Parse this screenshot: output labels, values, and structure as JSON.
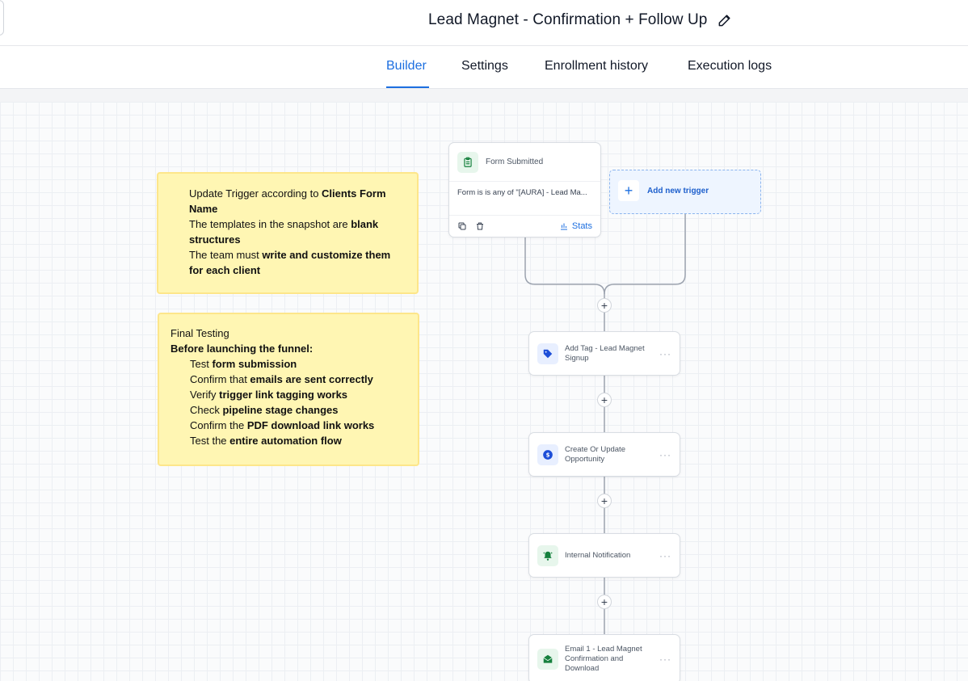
{
  "header": {
    "title": "Lead Magnet - Confirmation + Follow Up"
  },
  "tabs": [
    {
      "label": "Builder",
      "active": true
    },
    {
      "label": "Settings",
      "active": false
    },
    {
      "label": "Enrollment history",
      "active": false
    },
    {
      "label": "Execution logs",
      "active": false
    }
  ],
  "notes": {
    "note1": {
      "l1a": "Update Trigger according to ",
      "l1b": "Clients Form Name",
      "l2a": "The templates in the snapshot are ",
      "l2b": "blank structures",
      "l3a": "The team must ",
      "l3b": "write and customize them for each client"
    },
    "note2": {
      "heading": "Final Testing",
      "subheading": "Before launching the funnel:",
      "items": [
        {
          "a": "Test ",
          "b": "form submission"
        },
        {
          "a": "Confirm that ",
          "b": "emails are sent correctly"
        },
        {
          "a": "Verify ",
          "b": "trigger link tagging works"
        },
        {
          "a": "Check ",
          "b": "pipeline stage changes"
        },
        {
          "a": "Confirm the ",
          "b": "PDF download link works"
        },
        {
          "a": "Test the ",
          "b": "entire automation flow"
        }
      ]
    }
  },
  "trigger": {
    "title": "Form Submitted",
    "condition": "Form is is any of \"[AURA] - Lead Ma...",
    "stats_label": "Stats"
  },
  "add_trigger": {
    "label": "Add new trigger"
  },
  "actions": [
    {
      "label": "Add Tag - Lead Magnet Signup",
      "icon": "tag-icon"
    },
    {
      "label": "Create Or Update Opportunity",
      "icon": "dollar-icon"
    },
    {
      "label": "Internal Notification",
      "icon": "bell-icon"
    },
    {
      "label": "Email 1 - Lead Magnet Confirmation and Download",
      "icon": "mail-icon"
    }
  ],
  "colors": {
    "accent": "#1d6fe0",
    "note_bg": "#fff6b3",
    "note_border": "#fde68a"
  }
}
